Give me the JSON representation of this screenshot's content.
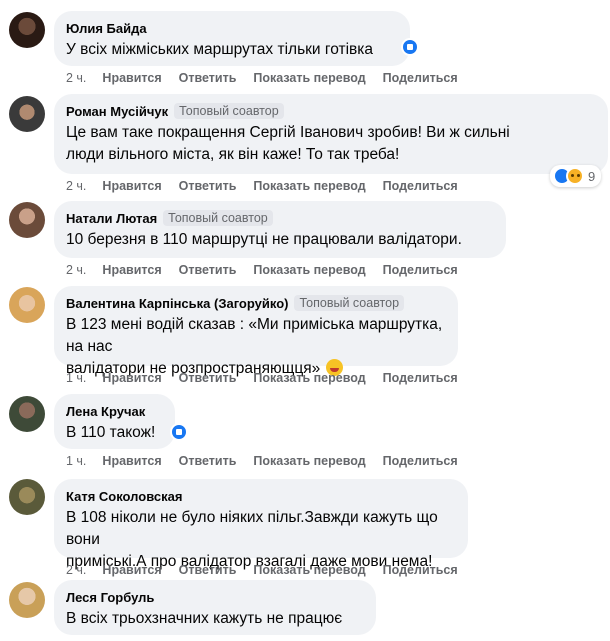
{
  "labels": {
    "like": "Нравится",
    "reply": "Ответить",
    "translate": "Показать перевод",
    "share": "Поделиться"
  },
  "comments": [
    {
      "name": "Юлия Байда",
      "badge": "",
      "lines": [
        "У всіх міжміських маршрутах тільки готівка"
      ],
      "time": "2 ч."
    },
    {
      "name": "Роман Мусійчук",
      "badge": "Топовый соавтор",
      "lines": [
        "Це вам таке покращення Сергій Іванович зробив! Ви ж сильні",
        "люди вільного міста, як він каже! То так треба!"
      ],
      "time": "2 ч.",
      "reaction_count": "9"
    },
    {
      "name": "Натали Лютая",
      "badge": "Топовый соавтор",
      "lines": [
        "10 березня в 110 маршрутці не працювали валідатори."
      ],
      "time": "2 ч."
    },
    {
      "name": "Валентина Карпінська (Загоруйко)",
      "badge": "Топовый соавтор",
      "lines": [
        "В 123 мені водій сказав : «Ми приміська маршрутка, на нас",
        "валідатори не розпространяющця»"
      ],
      "time": "1 ч."
    },
    {
      "name": "Лена Кручак",
      "badge": "",
      "lines": [
        "В 110 також!"
      ],
      "time": "1 ч."
    },
    {
      "name": "Катя Соколовская",
      "badge": "",
      "lines": [
        "В 108 ніколи не було ніяких пільг.Завжди кажуть що вони",
        "приміські.А про валідатор взагалі даже мови нема!"
      ],
      "time": "2 ч."
    },
    {
      "name": "Леся Горбуль",
      "badge": "",
      "lines": [
        "В всіх трьохзначних кажуть не працює"
      ]
    }
  ],
  "colors": {
    "bubble": "#f0f2f5",
    "muted": "#65676b",
    "accent": "#1877f2"
  }
}
